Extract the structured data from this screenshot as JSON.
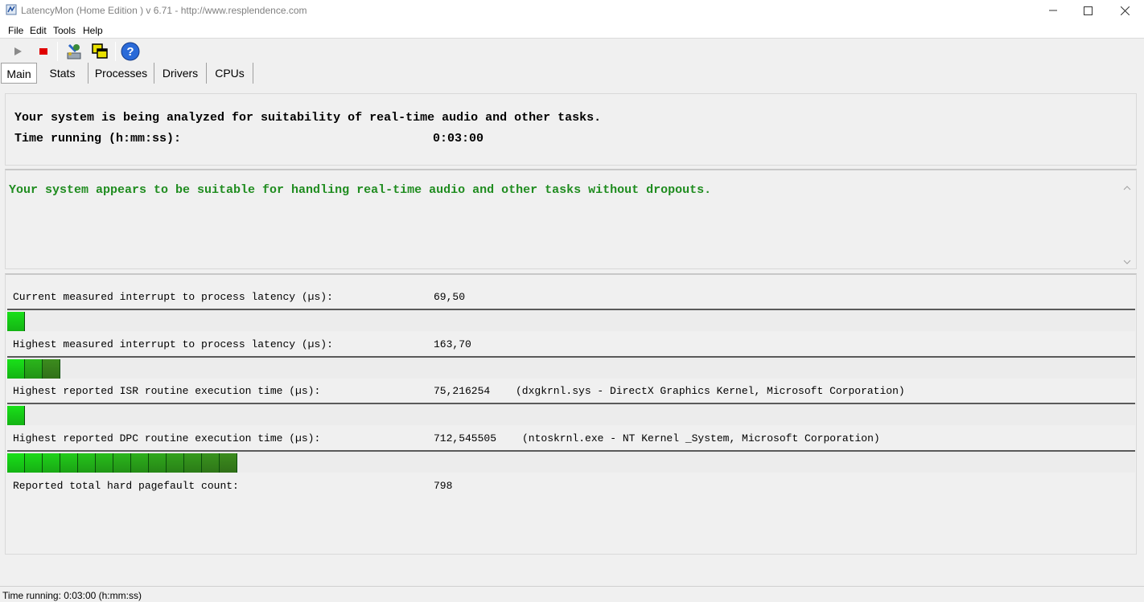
{
  "window": {
    "title": "LatencyMon  (Home Edition )  v 6.71 - http://www.resplendence.com"
  },
  "menu": [
    "File",
    "Edit",
    "Tools",
    "Help"
  ],
  "toolbar": {
    "icons": [
      "play-icon",
      "stop-icon",
      "analyze-icon",
      "windows-icon",
      "help-icon"
    ]
  },
  "tabs": [
    "Main",
    "Stats",
    "Processes",
    "Drivers",
    "CPUs"
  ],
  "analysis": {
    "status_line": "Your system is being analyzed for suitability of real-time audio and other tasks.",
    "time_label": "Time running (h:mm:ss):",
    "time_value": "0:03:00"
  },
  "result_message": "Your system appears to be suitable for handling real-time audio and other tasks without dropouts.",
  "metrics": [
    {
      "label": "Current measured interrupt to process latency (µs):",
      "value": "69,50",
      "detail": "",
      "level": 0.014
    },
    {
      "label": "Highest measured interrupt to process latency (µs):",
      "value": "163,70",
      "detail": "",
      "level": 0.044
    },
    {
      "label": "Highest reported ISR routine execution time (µs):",
      "value": "75,216254",
      "detail": "(dxgkrnl.sys - DirectX Graphics Kernel, Microsoft Corporation)",
      "level": 0.014
    },
    {
      "label": "Highest reported DPC routine execution time (µs):",
      "value": "712,545505",
      "detail": "(ntoskrnl.exe - NT Kernel _System, Microsoft Corporation)",
      "level": 0.203
    },
    {
      "label": "Reported total hard pagefault count:",
      "value": "798",
      "detail": ""
    }
  ],
  "status_bar": "Time running: 0:03:00  (h:mm:ss)",
  "colors": {
    "ok_text": "#1f8c1f",
    "bar_light": "#19e019",
    "bar_dark": "#3c8c1e"
  }
}
